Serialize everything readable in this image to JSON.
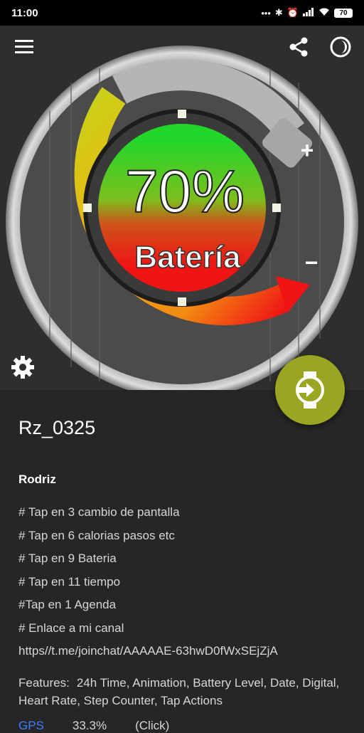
{
  "status_bar": {
    "time": "11:00",
    "icons": [
      "more-dots-icon",
      "bluetooth-icon",
      "alarm-icon",
      "signal-icon",
      "wifi-icon"
    ],
    "battery": "70"
  },
  "hero": {
    "percent": "70%",
    "label": "Batería",
    "plus": "+",
    "minus": "−",
    "battery_level": 0.7,
    "colors": {
      "accent": "#9aa521",
      "green": "#22d62a",
      "red": "#f01414",
      "yellow": "#f1c40f",
      "orange": "#f39c12"
    }
  },
  "info": {
    "title": "Rz_0325",
    "author": "Rodriz",
    "description": [
      "# Tap en 3 cambio de pantalla",
      "# Tap en 6 calorias pasos etc",
      "# Tap en 9 Bateria",
      "# Tap en 11 tiempo",
      "#Tap en 1 Agenda",
      "# Enlace a mi canal",
      "https//t.me/joinchat/AAAAAE-63hwD0fWxSEjZjA"
    ],
    "features_label": "Features:",
    "features": "24h Time,  Animation,  Battery Level,  Date,  Digital,  Heart Rate,  Step Counter,  Tap Actions"
  },
  "bottom_row": [
    "GPS",
    "33.3%",
    "(Click)"
  ]
}
